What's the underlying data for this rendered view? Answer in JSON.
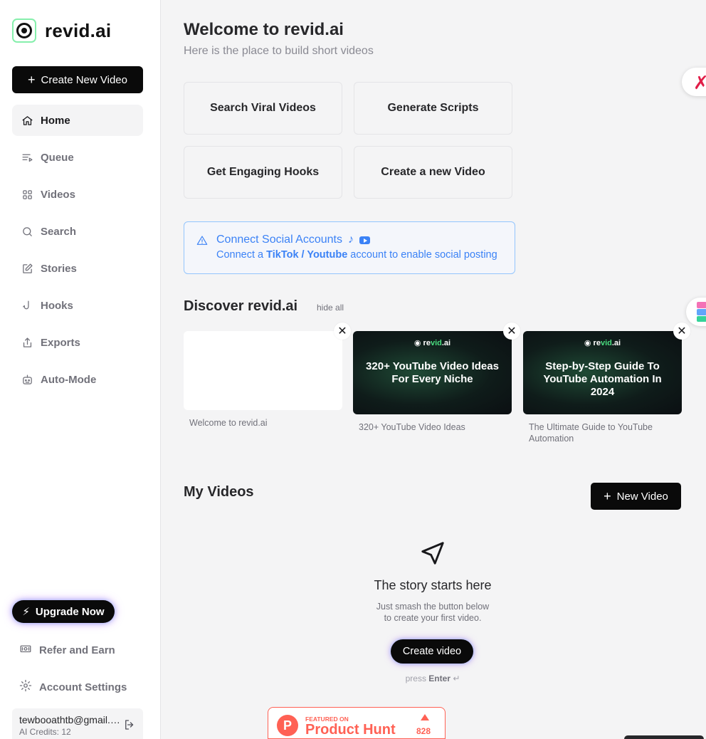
{
  "app": {
    "logo_text": "revid.ai"
  },
  "sidebar": {
    "create_button": "Create New Video",
    "items": [
      {
        "label": "Home",
        "icon": "home-icon",
        "active": true
      },
      {
        "label": "Queue",
        "icon": "queue-icon"
      },
      {
        "label": "Videos",
        "icon": "grid-icon"
      },
      {
        "label": "Search",
        "icon": "search-icon"
      },
      {
        "label": "Stories",
        "icon": "edit-icon"
      },
      {
        "label": "Hooks",
        "icon": "hook-icon"
      },
      {
        "label": "Exports",
        "icon": "share-icon"
      },
      {
        "label": "Auto-Mode",
        "icon": "robot-icon"
      }
    ],
    "upgrade_button": "Upgrade Now",
    "refer": "Refer and Earn",
    "settings": "Account Settings",
    "account": {
      "email": "tewbooathtb@gmail.com",
      "credits": "AI Credits: 12"
    }
  },
  "main": {
    "title": "Welcome to revid.ai",
    "subtitle": "Here is the place to build short videos",
    "actions": [
      "Search Viral Videos",
      "Generate Scripts",
      "Get Engaging Hooks",
      "Create a new Video"
    ],
    "connect": {
      "title": "Connect Social Accounts",
      "desc_prefix": "Connect a ",
      "desc_bold": "TikTok / Youtube",
      "desc_suffix": " account to enable social posting"
    },
    "discover": {
      "title": "Discover revid.ai",
      "hide_all": "hide all",
      "cards": [
        {
          "thumb_text": "",
          "label": "Welcome to revid.ai"
        },
        {
          "thumb_logo_a": "re",
          "thumb_logo_b": "vid",
          "thumb_logo_c": ".ai",
          "thumb_text": "320+ YouTube Video Ideas For Every Niche",
          "label": "320+ YouTube Video Ideas"
        },
        {
          "thumb_logo_a": "re",
          "thumb_logo_b": "vid",
          "thumb_logo_c": ".ai",
          "thumb_text": "Step-by-Step Guide To YouTube Automation In 2024",
          "label": "The Ultimate Guide to YouTube Automation"
        }
      ]
    },
    "my_videos": {
      "title": "My Videos",
      "new_button": "New Video",
      "empty_title": "The story starts here",
      "empty_desc_1": "Just smash the button below",
      "empty_desc_2": "to create your first video.",
      "create_button": "Create video",
      "press_prefix": "press",
      "press_key": "Enter"
    },
    "product_hunt": {
      "featured": "FEATURED ON",
      "name": "Product Hunt",
      "count": "828"
    }
  },
  "colors": {
    "accent_blue": "#3b82f6",
    "brand_green": "#4ade80",
    "product_hunt": "#ff6154"
  }
}
